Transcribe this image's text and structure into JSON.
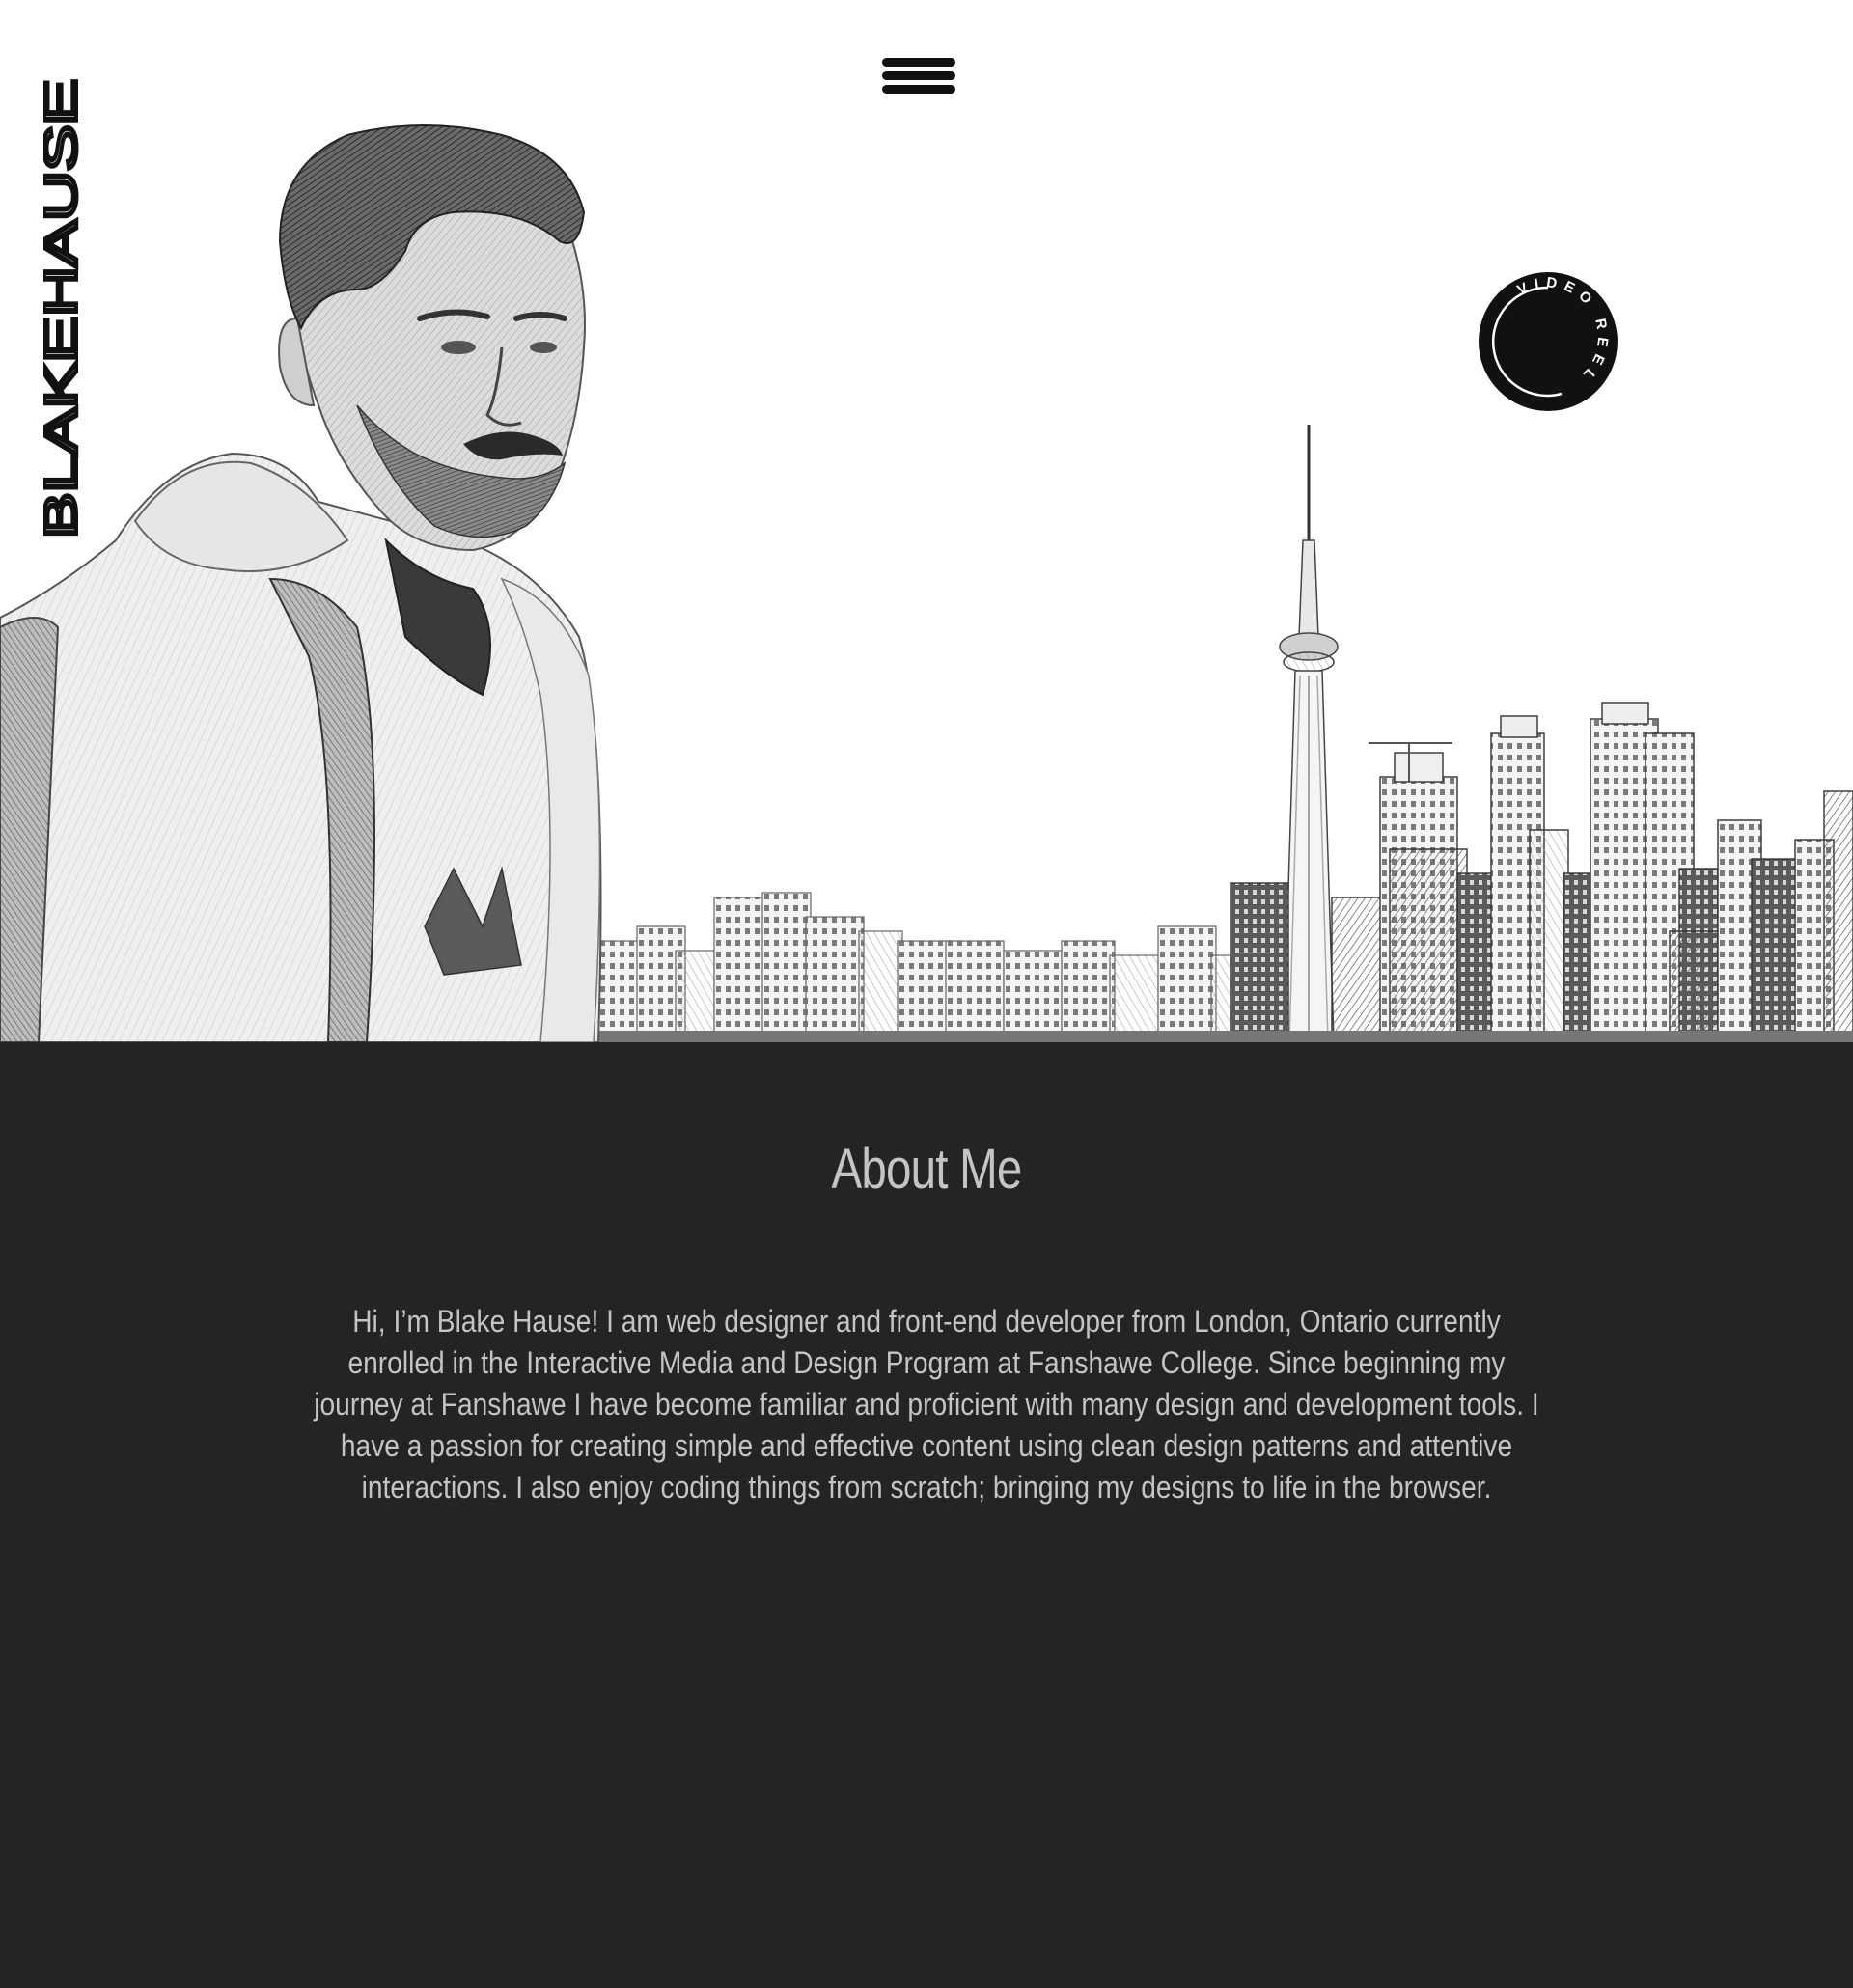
{
  "header": {
    "logo_text": "BLAKEHAUSE",
    "menu_icon": "hamburger-menu-icon",
    "video_reel_label": "VIDEO REEL"
  },
  "hero": {
    "portrait": "pencil-sketch-portrait",
    "background": "toronto-skyline-sketch"
  },
  "about": {
    "title": "About Me",
    "body": "Hi, I’m Blake Hause! I am web designer and front-end developer from London, Ontario currently enrolled in the Interactive Media and Design Program at Fanshawe College. Since beginning my journey at Fanshawe I have become familiar and proficient with many design and development tools. I have a passion for creating simple and effective content using clean design patterns and attentive interactions. I also enjoy coding things from scratch; bringing my designs to life in the browser."
  },
  "colors": {
    "hero_bg": "#ffffff",
    "about_bg": "#242424",
    "about_text": "#c4c4c4",
    "ink": "#111111"
  }
}
